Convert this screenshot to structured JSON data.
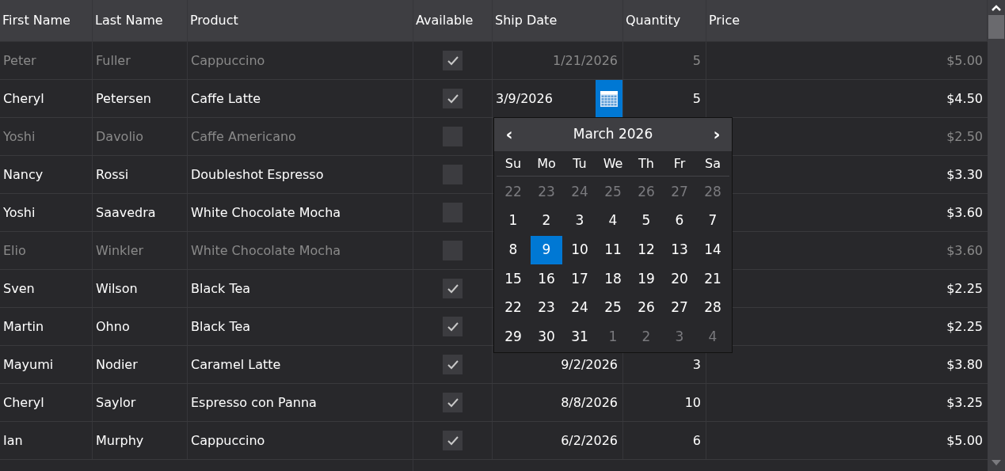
{
  "table": {
    "columns": [
      "First Name",
      "Last Name",
      "Product",
      "Available",
      "Ship Date",
      "Quantity",
      "Price"
    ],
    "rows": [
      {
        "first_name": "Peter",
        "last_name": "Fuller",
        "product": "Cappuccino",
        "available": true,
        "ship_date": "1/21/2026",
        "quantity": "5",
        "price": "$5.00",
        "disabled": true,
        "editing": false
      },
      {
        "first_name": "Cheryl",
        "last_name": "Petersen",
        "product": "Caffe Latte",
        "available": true,
        "ship_date": "3/9/2026",
        "quantity": "5",
        "price": "$4.50",
        "disabled": false,
        "editing": true
      },
      {
        "first_name": "Yoshi",
        "last_name": "Davolio",
        "product": "Caffe Americano",
        "available": false,
        "price": "$2.50",
        "disabled": true
      },
      {
        "first_name": "Nancy",
        "last_name": "Rossi",
        "product": "Doubleshot Espresso",
        "available": false,
        "price": "$3.30",
        "disabled": false
      },
      {
        "first_name": "Yoshi",
        "last_name": "Saavedra",
        "product": "White Chocolate Mocha",
        "available": false,
        "price": "$3.60",
        "disabled": false
      },
      {
        "first_name": "Elio",
        "last_name": "Winkler",
        "product": "White Chocolate Mocha",
        "available": false,
        "price": "$3.60",
        "disabled": true
      },
      {
        "first_name": "Sven",
        "last_name": "Wilson",
        "product": "Black Tea",
        "available": true,
        "price": "$2.25",
        "disabled": false
      },
      {
        "first_name": "Martin",
        "last_name": "Ohno",
        "product": "Black Tea",
        "available": true,
        "price": "$2.25",
        "disabled": false
      },
      {
        "first_name": "Mayumi",
        "last_name": "Nodier",
        "product": "Caramel Latte",
        "available": true,
        "ship_date": "9/2/2026",
        "quantity": "3",
        "price": "$3.80",
        "disabled": false,
        "editing": false
      },
      {
        "first_name": "Cheryl",
        "last_name": "Saylor",
        "product": "Espresso con Panna",
        "available": true,
        "ship_date": "8/8/2026",
        "quantity": "10",
        "price": "$3.25",
        "disabled": false,
        "editing": false
      },
      {
        "first_name": "Ian",
        "last_name": "Murphy",
        "product": "Cappuccino",
        "available": true,
        "ship_date": "6/2/2026",
        "quantity": "6",
        "price": "$5.00",
        "disabled": false,
        "editing": false
      }
    ]
  },
  "calendar": {
    "prev": "‹",
    "title": "March 2026",
    "next": "›",
    "weekdays": [
      "Su",
      "Mo",
      "Tu",
      "We",
      "Th",
      "Fr",
      "Sa"
    ],
    "days": [
      {
        "day": "22",
        "other_month": true,
        "selected": false
      },
      {
        "day": "23",
        "other_month": true,
        "selected": false
      },
      {
        "day": "24",
        "other_month": true,
        "selected": false
      },
      {
        "day": "25",
        "other_month": true,
        "selected": false
      },
      {
        "day": "26",
        "other_month": true,
        "selected": false
      },
      {
        "day": "27",
        "other_month": true,
        "selected": false
      },
      {
        "day": "28",
        "other_month": true,
        "selected": false
      },
      {
        "day": "1",
        "other_month": false,
        "selected": false
      },
      {
        "day": "2",
        "other_month": false,
        "selected": false
      },
      {
        "day": "3",
        "other_month": false,
        "selected": false
      },
      {
        "day": "4",
        "other_month": false,
        "selected": false
      },
      {
        "day": "5",
        "other_month": false,
        "selected": false
      },
      {
        "day": "6",
        "other_month": false,
        "selected": false
      },
      {
        "day": "7",
        "other_month": false,
        "selected": false
      },
      {
        "day": "8",
        "other_month": false,
        "selected": false
      },
      {
        "day": "9",
        "other_month": false,
        "selected": true
      },
      {
        "day": "10",
        "other_month": false,
        "selected": false
      },
      {
        "day": "11",
        "other_month": false,
        "selected": false
      },
      {
        "day": "12",
        "other_month": false,
        "selected": false
      },
      {
        "day": "13",
        "other_month": false,
        "selected": false
      },
      {
        "day": "14",
        "other_month": false,
        "selected": false
      },
      {
        "day": "15",
        "other_month": false,
        "selected": false
      },
      {
        "day": "16",
        "other_month": false,
        "selected": false
      },
      {
        "day": "17",
        "other_month": false,
        "selected": false
      },
      {
        "day": "18",
        "other_month": false,
        "selected": false
      },
      {
        "day": "19",
        "other_month": false,
        "selected": false
      },
      {
        "day": "20",
        "other_month": false,
        "selected": false
      },
      {
        "day": "21",
        "other_month": false,
        "selected": false
      },
      {
        "day": "22",
        "other_month": false,
        "selected": false
      },
      {
        "day": "23",
        "other_month": false,
        "selected": false
      },
      {
        "day": "24",
        "other_month": false,
        "selected": false
      },
      {
        "day": "25",
        "other_month": false,
        "selected": false
      },
      {
        "day": "26",
        "other_month": false,
        "selected": false
      },
      {
        "day": "27",
        "other_month": false,
        "selected": false
      },
      {
        "day": "28",
        "other_month": false,
        "selected": false
      },
      {
        "day": "29",
        "other_month": false,
        "selected": false
      },
      {
        "day": "30",
        "other_month": false,
        "selected": false
      },
      {
        "day": "31",
        "other_month": false,
        "selected": false
      },
      {
        "day": "1",
        "other_month": true,
        "selected": false
      },
      {
        "day": "2",
        "other_month": true,
        "selected": false
      },
      {
        "day": "3",
        "other_month": true,
        "selected": false
      },
      {
        "day": "4",
        "other_month": true,
        "selected": false
      }
    ]
  }
}
